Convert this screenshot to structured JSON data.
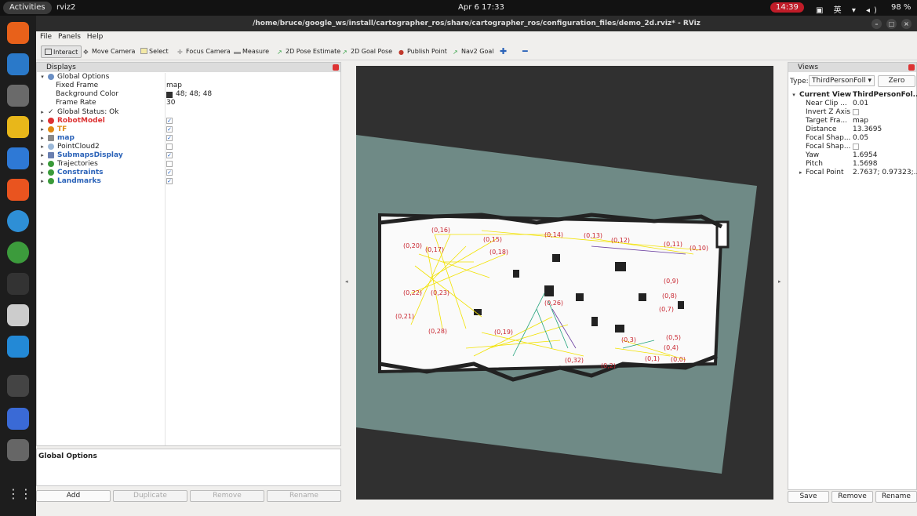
{
  "system": {
    "activities": "Activities",
    "app_name": "rviz2",
    "clock": "Apr 6  17:33",
    "recording": "14:39",
    "battery": "98 %",
    "ime": "英"
  },
  "window": {
    "title": "/home/bruce/google_ws/install/cartographer_ros/share/cartographer_ros/configuration_files/demo_2d.rviz* - RViz"
  },
  "menu": [
    "File",
    "Panels",
    "Help"
  ],
  "toolbar": [
    "Interact",
    "Move Camera",
    "Select",
    "Focus Camera",
    "Measure",
    "2D Pose Estimate",
    "2D Goal Pose",
    "Publish Point",
    "Nav2 Goal"
  ],
  "displays": {
    "title": "Displays",
    "global_options": "Global Options",
    "fixed_frame": {
      "label": "Fixed Frame",
      "value": "map"
    },
    "background_color": {
      "label": "Background Color",
      "value": "48; 48; 48"
    },
    "frame_rate": {
      "label": "Frame Rate",
      "value": "30"
    },
    "global_status": "Global Status: Ok",
    "items": [
      {
        "label": "RobotModel",
        "checked": "✓"
      },
      {
        "label": "TF",
        "checked": "✓"
      },
      {
        "label": "map",
        "checked": "✓"
      },
      {
        "label": "PointCloud2",
        "checked": ""
      },
      {
        "label": "SubmapsDisplay",
        "checked": "✓"
      },
      {
        "label": "Trajectories",
        "checked": ""
      },
      {
        "label": "Constraints",
        "checked": "✓"
      },
      {
        "label": "Landmarks",
        "checked": "✓"
      }
    ],
    "description_title": "Global Options",
    "buttons": [
      "Add",
      "Duplicate",
      "Remove",
      "Rename"
    ]
  },
  "views": {
    "title": "Views",
    "type_label": "Type:",
    "type_value": "ThirdPersonFoll",
    "zero": "Zero",
    "current_view": "Current View",
    "current_view_value": "ThirdPersonFol...",
    "props": [
      {
        "label": "Near Clip ...",
        "value": "0.01"
      },
      {
        "label": "Invert Z Axis",
        "value": ""
      },
      {
        "label": "Target Fra...",
        "value": "map"
      },
      {
        "label": "Distance",
        "value": "13.3695"
      },
      {
        "label": "Focal Shap...",
        "value": "0.05"
      },
      {
        "label": "Focal Shap...",
        "value": ""
      },
      {
        "label": "Yaw",
        "value": "1.6954"
      },
      {
        "label": "Pitch",
        "value": "1.5698"
      },
      {
        "label": "Focal Point",
        "value": "2.7637; 0.97323;..."
      }
    ],
    "buttons": [
      "Save",
      "Remove",
      "Rename"
    ]
  },
  "landmarks": [
    "(0,16)",
    "(0,20)",
    "(0,17)",
    "(0,18)",
    "(0,15)",
    "(0,14)",
    "(0,13)",
    "(0,12)",
    "(0,11)",
    "(0,10)",
    "(0,9)",
    "(0,8)",
    "(0,7)",
    "(0,6)",
    "(0,22)",
    "(0,23)",
    "(0,21)",
    "(0,28)",
    "(0,19)",
    "(0,5)",
    "(0,4)",
    "(0,3)",
    "(0,1)",
    "(0,0)",
    "(0,2)",
    "(0,32)",
    "(0,26)"
  ]
}
